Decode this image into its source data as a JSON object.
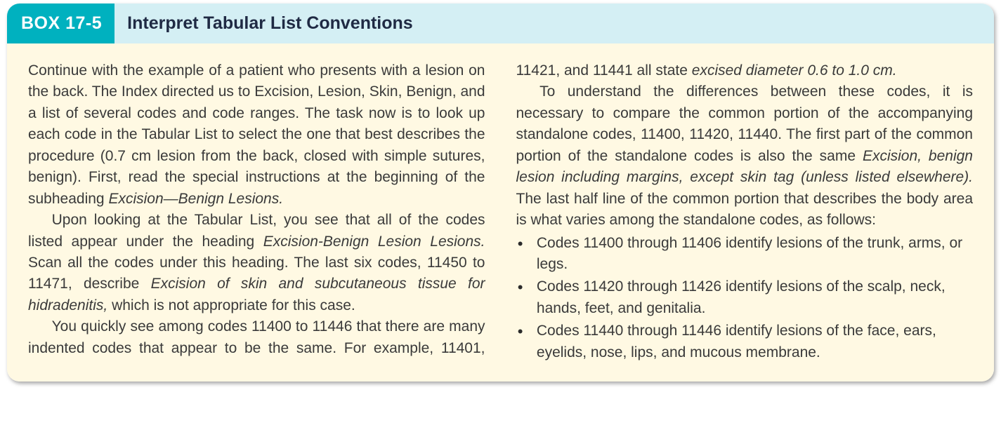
{
  "header": {
    "box_label": "BOX 17-5",
    "title": "Interpret Tabular List Conventions"
  },
  "content": {
    "p1a": "Continue with the example of a patient who presents with a lesion on the back. The Index directed us to Excision, Lesion, Skin, Benign, and a list of several codes and code ranges. The task now is to look up each code in the Tabular List to select the one that best describes the procedure (0.7 cm lesion from the back, closed with simple sutures, benign). First, read the special instructions at the beginning of the subheading ",
    "p1i": "Excision—Benign Lesions.",
    "p2a": "Upon looking at the Tabular List, you see that all of the codes listed appear under the heading ",
    "p2i1": "Excision-Benign Lesion Lesions.",
    "p2b": " Scan all the codes under this heading. The last six codes, 11450 to 11471, describe ",
    "p2i2": "Excision of skin and subcutaneous tissue for hidradenitis,",
    "p2c": " which is not appropriate for this case.",
    "p3a": "You quickly see among codes 11400 to 11446 that there are many indented codes that appear to be the same. For example, 11401, 11421, and 11441 all state ",
    "p3i": "excised diameter 0.6 to 1.0 cm.",
    "p4a": "To understand the differences between these codes, it is necessary to compare the common portion of the accompanying standalone codes, 11400, 11420, 11440. The first part of the common portion of the standalone codes is also the same ",
    "p4i": "Excision, benign lesion including margins, except skin tag (unless listed elsewhere).",
    "p4b": " The last half line of the common portion that describes the body area is what varies among the standalone codes, as follows:",
    "bullets": {
      "b1": "Codes 11400 through 11406 identify lesions of the trunk, arms, or legs.",
      "b2": "Codes 11420 through 11426 identify lesions of the scalp, neck, hands, feet, and genitalia.",
      "b3": "Codes 11440 through 11446 identify lesions of the face, ears, eyelids, nose, lips, and mucous membrane."
    }
  }
}
